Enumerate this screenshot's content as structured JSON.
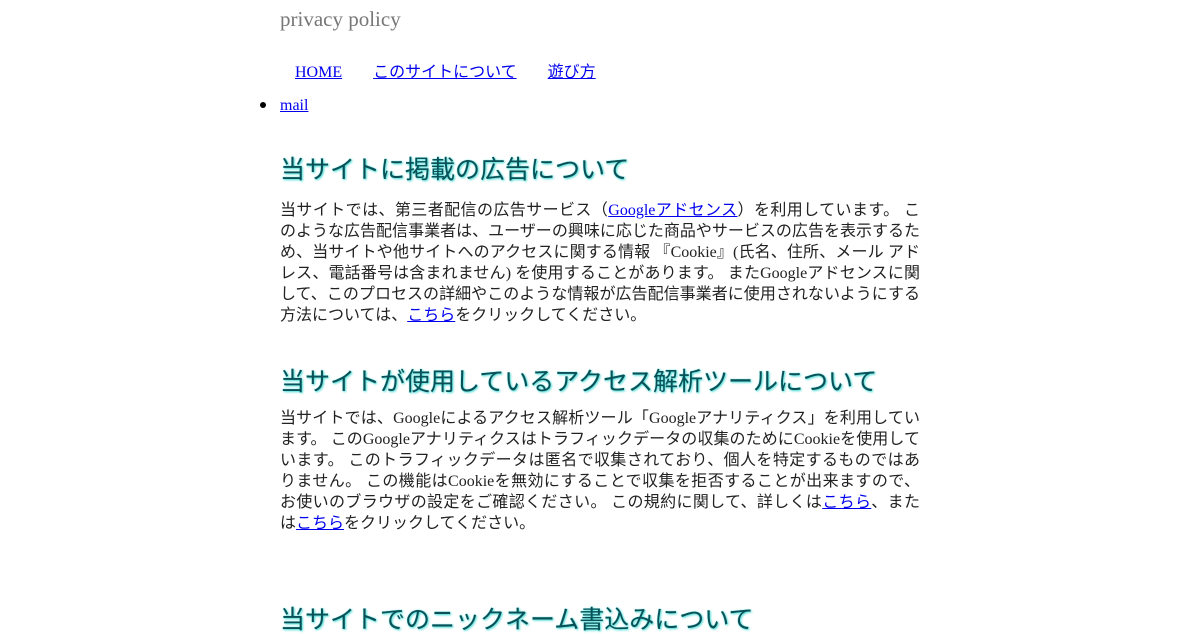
{
  "header": {
    "site_title": "privacy policy"
  },
  "nav": {
    "items": [
      {
        "label": "HOME"
      },
      {
        "label": "このサイトについて"
      },
      {
        "label": "遊び方"
      }
    ],
    "mail_label": "mail"
  },
  "sections": [
    {
      "title": "当サイトに掲載の広告について",
      "text_1": "当サイトでは、第三者配信の広告サービス（",
      "link_1": "Googleアドセンス",
      "text_2": "）を利用しています。 このような広告配信事業者は、ユーザーの興味に応じた商品やサービスの広告を表示するため、当サイトや他サイトへのアクセスに関する情報 『Cookie』(氏名、住所、メール アドレス、電話番号は含まれません) を使用することがあります。 またGoogleアドセンスに関して、このプロセスの詳細やこのような情報が広告配信事業者に使用されないようにする方法については、",
      "link_2": "こちら",
      "text_3": "をクリックしてください。"
    },
    {
      "title": "当サイトが使用しているアクセス解析ツールについて",
      "text_1": "当サイトでは、Googleによるアクセス解析ツール「Googleアナリティクス」を利用しています。 このGoogleアナリティクスはトラフィックデータの収集のためにCookieを使用しています。 このトラフィックデータは匿名で収集されており、個人を特定するものではありません。 この機能はCookieを無効にすることで収集を拒否することが出来ますので、お使いのブラウザの設定をご確認ください。 この規約に関して、詳しくは",
      "link_1": "こちら",
      "text_2": "、または",
      "link_2": "こちら",
      "text_3": "をクリックしてください。"
    },
    {
      "title": "当サイトでのニックネーム書込みについて"
    }
  ]
}
